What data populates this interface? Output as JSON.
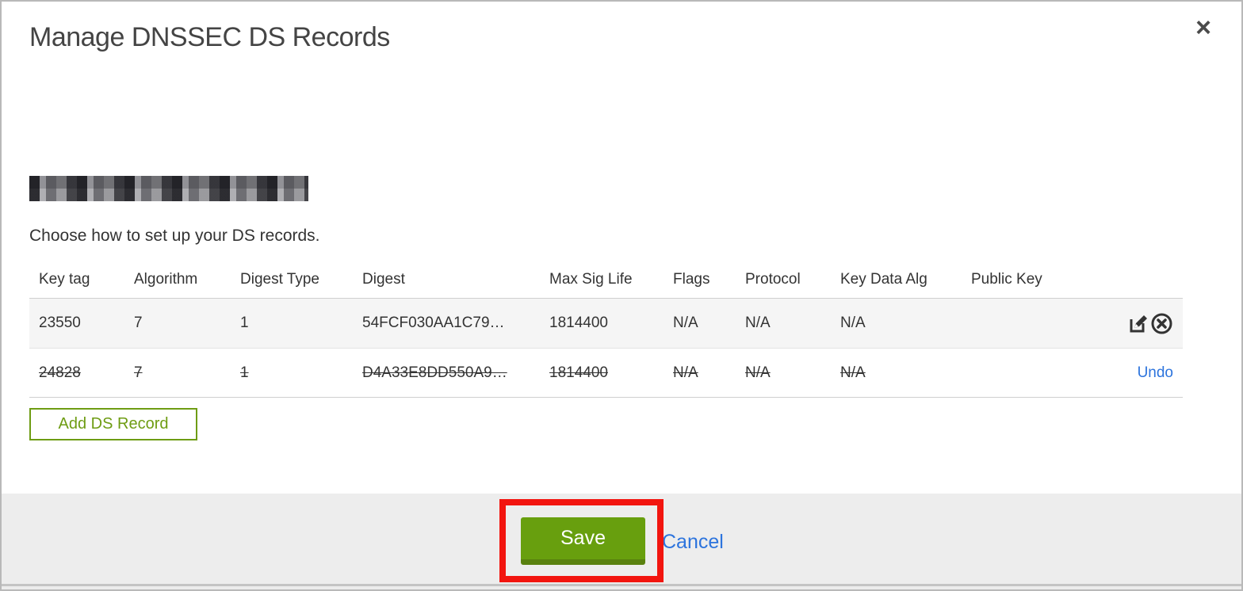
{
  "header": {
    "title": "Manage DNSSEC DS Records",
    "close_icon": "close-x"
  },
  "intro": {
    "instruction": "Choose how to set up your DS records.",
    "domain_note": "redacted-domain-name"
  },
  "table": {
    "columns": [
      "Key tag",
      "Algorithm",
      "Digest Type",
      "Digest",
      "Max Sig Life",
      "Flags",
      "Protocol",
      "Key Data Alg",
      "Public Key"
    ],
    "rows": [
      {
        "key_tag": "23550",
        "algorithm": "7",
        "digest_type": "1",
        "digest": "54FCF030AA1C79…",
        "max_sig_life": "1814400",
        "flags": "N/A",
        "protocol": "N/A",
        "key_data_alg": "N/A",
        "public_key": "",
        "state": "active",
        "action_icons": [
          "edit-icon",
          "remove-icon"
        ]
      },
      {
        "key_tag": "24828",
        "algorithm": "7",
        "digest_type": "1",
        "digest": "D4A33E8DD550A9…",
        "max_sig_life": "1814400",
        "flags": "N/A",
        "protocol": "N/A",
        "key_data_alg": "N/A",
        "public_key": "",
        "state": "deleted",
        "undo_label": "Undo"
      }
    ]
  },
  "buttons": {
    "add_ds_record": "Add DS Record",
    "save": "Save",
    "cancel": "Cancel"
  },
  "colors": {
    "accent_green": "#689f0e",
    "outline_green": "#6e9c13",
    "link_blue": "#2d74dd",
    "annotation_red": "#f2150f",
    "row_gray": "#f5f5f5",
    "footer_gray": "#ededed"
  }
}
